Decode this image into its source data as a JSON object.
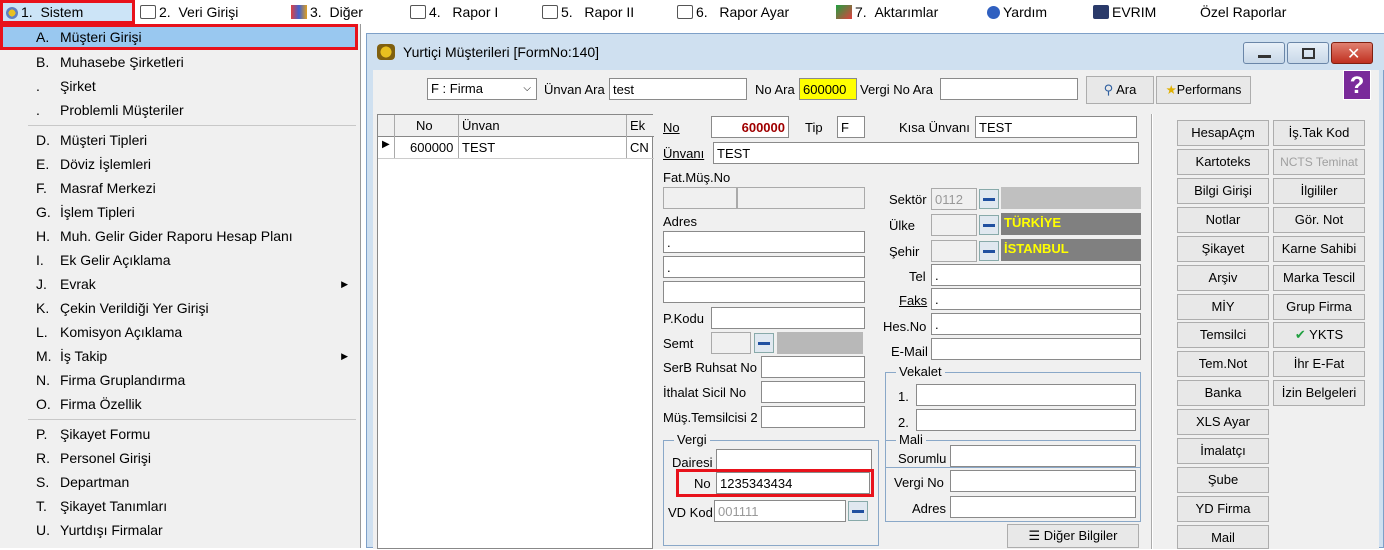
{
  "menubar": {
    "items": [
      {
        "num": "1.",
        "label": "Sistem",
        "icon": "system-icon"
      },
      {
        "num": "2.",
        "label": "Veri Girişi",
        "icon": "edit-icon"
      },
      {
        "num": "3.",
        "label": "Diğer",
        "icon": "people-icon"
      },
      {
        "num": "4.",
        "label": "Rapor I",
        "icon": "report-icon"
      },
      {
        "num": "5.",
        "label": "Rapor II",
        "icon": "printer-icon"
      },
      {
        "num": "6.",
        "label": "Rapor Ayar",
        "icon": "settings-icon"
      },
      {
        "num": "7.",
        "label": "Aktarımlar",
        "icon": "transfer-icon"
      },
      {
        "num": "",
        "label": "Yardım",
        "icon": "help-icon"
      },
      {
        "num": "",
        "label": "EVRIM",
        "icon": "evrim-icon"
      },
      {
        "num": "",
        "label": "Özel Raporlar",
        "icon": ""
      }
    ]
  },
  "dropdown": {
    "items": [
      {
        "k": "A.",
        "t": "Müşteri Girişi"
      },
      {
        "k": "B.",
        "t": "Muhasebe Şirketleri"
      },
      {
        "k": ".",
        "t": "Şirket"
      },
      {
        "k": ".",
        "t": "Problemli Müşteriler"
      },
      {
        "k": "D.",
        "t": "Müşteri Tipleri"
      },
      {
        "k": "E.",
        "t": "Döviz İşlemleri"
      },
      {
        "k": "F.",
        "t": "Masraf Merkezi"
      },
      {
        "k": "G.",
        "t": "İşlem Tipleri"
      },
      {
        "k": "H.",
        "t": "Muh. Gelir Gider Raporu Hesap Planı"
      },
      {
        "k": "I.",
        "t": "Ek Gelir Açıklama"
      },
      {
        "k": "J.",
        "t": "Evrak"
      },
      {
        "k": "K.",
        "t": "Çekin Verildiği Yer Girişi"
      },
      {
        "k": "L.",
        "t": "Komisyon Açıklama"
      },
      {
        "k": "M.",
        "t": "İş Takip"
      },
      {
        "k": "N.",
        "t": "Firma Gruplandırma"
      },
      {
        "k": "O.",
        "t": "Firma Özellik"
      },
      {
        "k": "P.",
        "t": "Şikayet Formu"
      },
      {
        "k": "R.",
        "t": "Personel Girişi"
      },
      {
        "k": "S.",
        "t": "Departman"
      },
      {
        "k": "T.",
        "t": "Şikayet Tanımları"
      },
      {
        "k": "U.",
        "t": "Yurtdışı Firmalar"
      }
    ]
  },
  "window": {
    "title": "Yurtiçi Müşterileri [FormNo:140]"
  },
  "search": {
    "type_value": "F : Firma",
    "unvan_label": "Ünvan Ara",
    "unvan_value": "test",
    "no_label": "No Ara",
    "no_value": "600000",
    "vergi_label": "Vergi No Ara",
    "vergi_value": "",
    "ara_button": "Ara",
    "performans_button": "Performans"
  },
  "grid": {
    "columns": [
      "No",
      "Ünvan",
      "Ek"
    ],
    "rows": [
      {
        "no": "600000",
        "unvan": "TEST",
        "ek": "CN"
      }
    ]
  },
  "form": {
    "no_label": "No",
    "no_value": "600000",
    "tip_label": "Tip",
    "tip_value": "F",
    "kisa_label": "Kısa Ünvanı",
    "kisa_value": "TEST",
    "unvan_label": "Ünvanı",
    "unvan_value": "TEST",
    "fatmus_label": "Fat.Müş.No",
    "adres_label": "Adres",
    "adres1": ".",
    "adres2": ".",
    "adres3": "",
    "pkodu_label": "P.Kodu",
    "semt_label": "Semt",
    "serb_label": "SerB Ruhsat No",
    "ithalat_label": "İthalat Sicil No",
    "mustem_label": "Müş.Temsilcisi 2",
    "sektor_label": "Sektör",
    "sektor_value": "0112",
    "ulke_label": "Ülke",
    "ulke_name": "TÜRKİYE",
    "sehir_label": "Şehir",
    "sehir_name": "İSTANBUL",
    "tel_label": "Tel",
    "tel_value": ".",
    "faks_label": "Faks",
    "faks_value": ".",
    "hesno_label": "Hes.No",
    "hesno_value": ".",
    "email_label": "E-Mail",
    "vekalet_title": "Vekalet",
    "vek1": "1.",
    "vek2": "2.",
    "vergi_title": "Vergi",
    "dairesi_label": "Dairesi",
    "no2_label": "No",
    "no2_value": "1235343434",
    "vdkod_label": "VD Kod",
    "vdkod_value": "001111",
    "mali_title": "Mali",
    "sorumlu_label": "Sorumlu",
    "vergino_label": "Vergi No",
    "adres2_label": "Adres",
    "diger_button": "Diğer Bilgiler"
  },
  "buttons_left": [
    "HesapAçm",
    "Kartoteks",
    "Bilgi Girişi",
    "Notlar",
    "Şikayet",
    "Arşiv",
    "MİY",
    "Temsilci",
    "Tem.Not",
    "Banka",
    "XLS Ayar",
    "İmalatçı",
    "Şube",
    "YD Firma",
    "Mail"
  ],
  "buttons_right": [
    "İş.Tak Kod",
    "NCTS Teminat",
    "İlgililer",
    "Gör. Not",
    "Karne Sahibi",
    "Marka Tescil",
    "Grup Firma",
    "YKTS",
    "İhr E-Fat",
    "İzin Belgeleri"
  ]
}
